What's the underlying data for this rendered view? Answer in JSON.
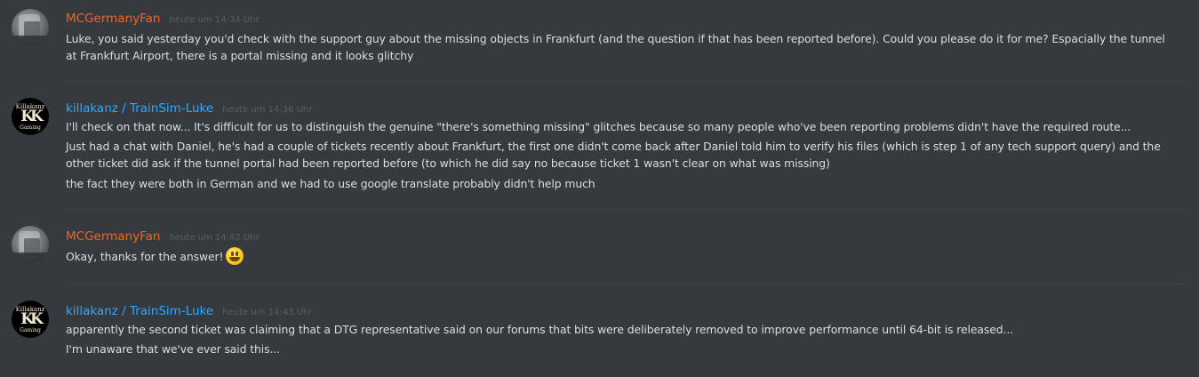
{
  "colors": {
    "background": "#36393e",
    "mc_username": "#f26522",
    "luke_username": "#2ea9ff",
    "text": "#dcddde",
    "timestamp": "#5b5e63"
  },
  "messages": [
    {
      "author": "MCGermanyFan",
      "timestamp": "heute um 14:34 Uhr",
      "avatar_icon": "landscape-photo-avatar",
      "lines": [
        "Luke, you said yesterday you'd check with the support guy about the missing objects in Frankfurt (and the question if that has been reported before). Could you please do it for me? Espacially the tunnel at Frankfurt Airport, there is a portal missing and it looks glitchy"
      ]
    },
    {
      "author": "killakanz / TrainSim-Luke",
      "timestamp": "heute um 14:36 Uhr",
      "avatar_icon": "killakanz-gaming-logo-avatar",
      "avatar_text_top": "Killakanz",
      "avatar_text_bottom": "Gaming",
      "lines": [
        "I'll check on that now... It's difficult for us to distinguish the genuine \"there's something missing\" glitches because so many people who've been reporting problems didn't have the required route...",
        "Just had a chat with Daniel, he's had a couple of tickets recently about Frankfurt, the first one didn't come back after Daniel told him to verify his files (which is step 1 of any tech support query) and the other ticket did ask if the tunnel portal had been reported before (to which he did say no because ticket 1 wasn't clear on what was missing)",
        "the fact they were both in German and we had to use google translate probably didn't help much"
      ]
    },
    {
      "author": "MCGermanyFan",
      "timestamp": "heute um 14:42 Uhr",
      "avatar_icon": "landscape-photo-avatar",
      "lines": [
        "Okay, thanks for the answer!"
      ],
      "emoji": "smiley-emoji"
    },
    {
      "author": "killakanz / TrainSim-Luke",
      "timestamp": "heute um 14:43 Uhr",
      "avatar_icon": "killakanz-gaming-logo-avatar",
      "avatar_text_top": "Killakanz",
      "avatar_text_bottom": "Gaming",
      "lines": [
        "apparently the second ticket was claiming that a DTG representative said on our forums that bits were deliberately removed to improve performance until 64-bit is released...",
        "I'm unaware that we've ever said this..."
      ]
    }
  ]
}
